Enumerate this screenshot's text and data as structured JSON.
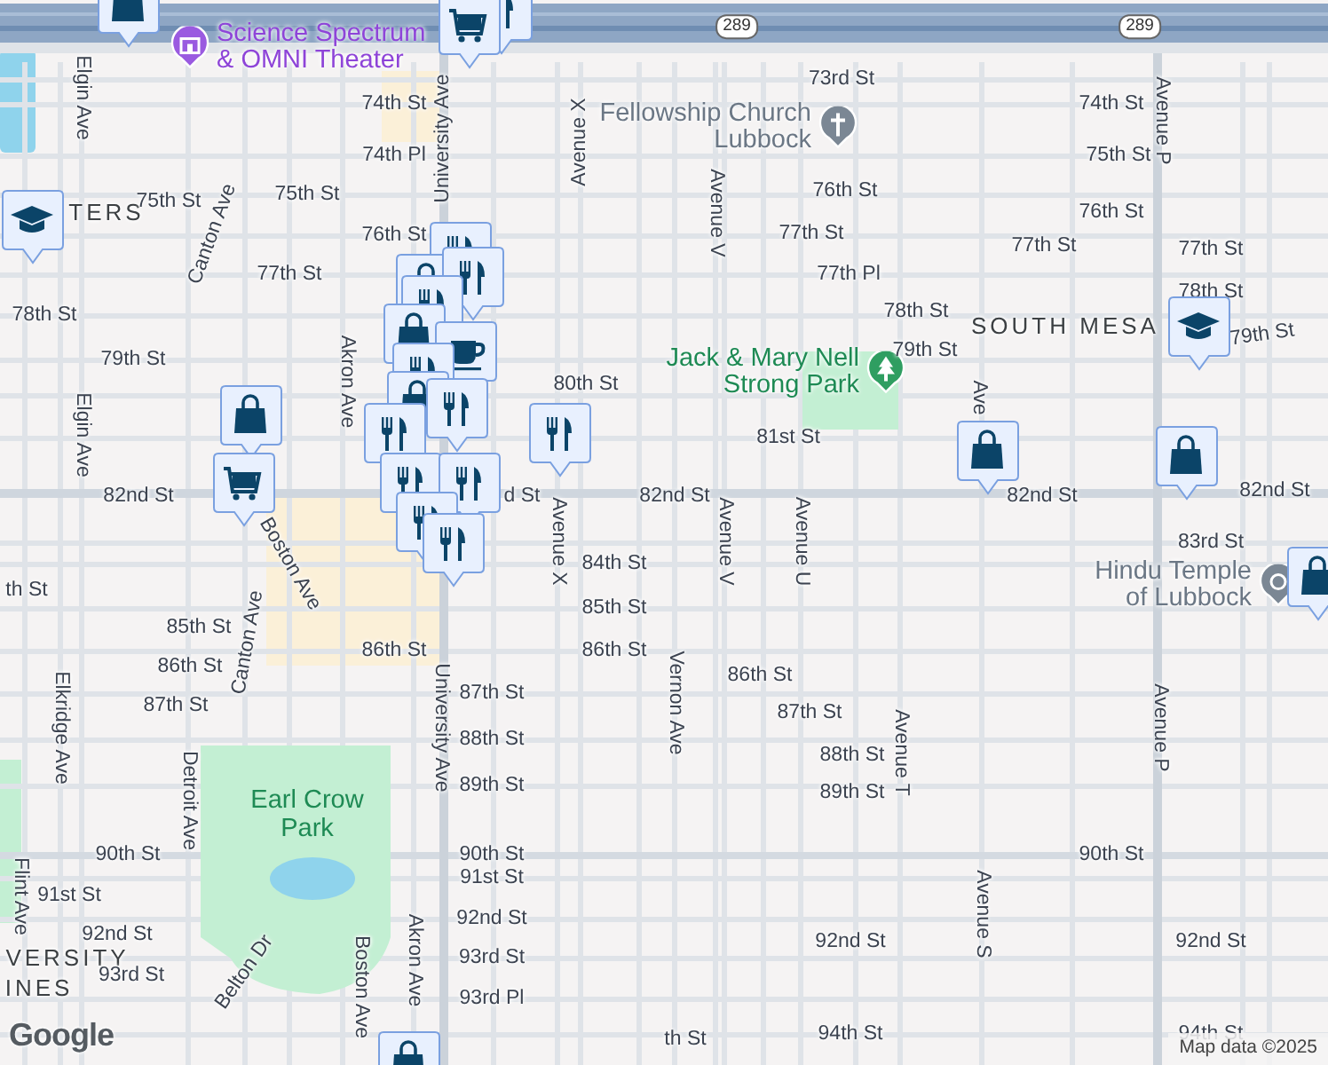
{
  "map": {
    "labels": [
      {
        "text": "Science Spectrum & OMNI Theater",
        "kind": "attraction"
      },
      {
        "text": "Fellowship Church Lubbock",
        "kind": "church"
      },
      {
        "text": "Jack & Mary Nell Strong Park",
        "kind": "park"
      },
      {
        "text": "Hindu Temple of Lubbock",
        "kind": "temple"
      },
      {
        "text": "Earl Crow Park",
        "kind": "park-area"
      },
      {
        "text": "SOUTH MESA",
        "kind": "district"
      },
      {
        "text": "TERS",
        "kind": "district"
      },
      {
        "text": "VERSITY",
        "kind": "district"
      },
      {
        "text": "INES",
        "kind": "district"
      },
      {
        "text": "73rd St",
        "kind": "street"
      },
      {
        "text": "74th St",
        "kind": "street"
      },
      {
        "text": "74th St",
        "kind": "street"
      },
      {
        "text": "74th Pl",
        "kind": "street"
      },
      {
        "text": "75th St",
        "kind": "street"
      },
      {
        "text": "75th St",
        "kind": "street"
      },
      {
        "text": "75th St",
        "kind": "street"
      },
      {
        "text": "76th St",
        "kind": "street"
      },
      {
        "text": "76th St",
        "kind": "street"
      },
      {
        "text": "76th St",
        "kind": "street"
      },
      {
        "text": "77th St",
        "kind": "street"
      },
      {
        "text": "77th St",
        "kind": "street"
      },
      {
        "text": "77th St",
        "kind": "street"
      },
      {
        "text": "77th Pl",
        "kind": "street"
      },
      {
        "text": "77th St",
        "kind": "street"
      },
      {
        "text": "78th St",
        "kind": "street"
      },
      {
        "text": "78th St",
        "kind": "street"
      },
      {
        "text": "78th St",
        "kind": "street"
      },
      {
        "text": "79th St",
        "kind": "street"
      },
      {
        "text": "79th St",
        "kind": "street"
      },
      {
        "text": "79th St",
        "kind": "street"
      },
      {
        "text": "80th St",
        "kind": "street"
      },
      {
        "text": "81st St",
        "kind": "street"
      },
      {
        "text": "82nd St",
        "kind": "street"
      },
      {
        "text": "d St",
        "kind": "street"
      },
      {
        "text": "82nd St",
        "kind": "street"
      },
      {
        "text": "82nd St",
        "kind": "street"
      },
      {
        "text": "82nd St",
        "kind": "street"
      },
      {
        "text": "83rd St",
        "kind": "street"
      },
      {
        "text": "84th St",
        "kind": "street"
      },
      {
        "text": "th St",
        "kind": "street"
      },
      {
        "text": "85th St",
        "kind": "street"
      },
      {
        "text": "85th St",
        "kind": "street"
      },
      {
        "text": "86th St",
        "kind": "street"
      },
      {
        "text": "86th St",
        "kind": "street"
      },
      {
        "text": "86th St",
        "kind": "street"
      },
      {
        "text": "86th St",
        "kind": "street"
      },
      {
        "text": "87th St",
        "kind": "street"
      },
      {
        "text": "87th St",
        "kind": "street"
      },
      {
        "text": "87th St",
        "kind": "street"
      },
      {
        "text": "88th St",
        "kind": "street"
      },
      {
        "text": "88th St",
        "kind": "street"
      },
      {
        "text": "89th St",
        "kind": "street"
      },
      {
        "text": "89th St",
        "kind": "street"
      },
      {
        "text": "90th St",
        "kind": "street"
      },
      {
        "text": "90th St",
        "kind": "street"
      },
      {
        "text": "90th St",
        "kind": "street"
      },
      {
        "text": "91st St",
        "kind": "street"
      },
      {
        "text": "91st St",
        "kind": "street"
      },
      {
        "text": "92nd St",
        "kind": "street"
      },
      {
        "text": "92nd St",
        "kind": "street"
      },
      {
        "text": "92nd St",
        "kind": "street"
      },
      {
        "text": "92nd St",
        "kind": "street"
      },
      {
        "text": "93rd St",
        "kind": "street"
      },
      {
        "text": "93rd St",
        "kind": "street"
      },
      {
        "text": "93rd Pl",
        "kind": "street"
      },
      {
        "text": "th St",
        "kind": "street"
      },
      {
        "text": "94th St",
        "kind": "street"
      },
      {
        "text": "94th St",
        "kind": "street"
      },
      {
        "text": "Elgin Ave",
        "kind": "street"
      },
      {
        "text": "Elgin Ave",
        "kind": "street"
      },
      {
        "text": "University Ave",
        "kind": "street"
      },
      {
        "text": "University Ave",
        "kind": "street"
      },
      {
        "text": "Avenue X",
        "kind": "street"
      },
      {
        "text": "Avenue X",
        "kind": "street"
      },
      {
        "text": "Avenue V",
        "kind": "street"
      },
      {
        "text": "Avenue V",
        "kind": "street"
      },
      {
        "text": "Avenue U",
        "kind": "street"
      },
      {
        "text": "Avenue T",
        "kind": "street"
      },
      {
        "text": "Avenue S",
        "kind": "street"
      },
      {
        "text": "Avenue P",
        "kind": "street"
      },
      {
        "text": "Avenue P",
        "kind": "street"
      },
      {
        "text": "Vernon Ave",
        "kind": "street"
      },
      {
        "text": "Canton Ave",
        "kind": "street"
      },
      {
        "text": "Canton Ave",
        "kind": "street"
      },
      {
        "text": "Akron Ave",
        "kind": "street"
      },
      {
        "text": "Akron Ave",
        "kind": "street"
      },
      {
        "text": "Boston Ave",
        "kind": "street"
      },
      {
        "text": "Boston Ave",
        "kind": "street"
      },
      {
        "text": "Elkridge Ave",
        "kind": "street"
      },
      {
        "text": "Detroit Ave",
        "kind": "street"
      },
      {
        "text": "Flint Ave",
        "kind": "street"
      },
      {
        "text": "Belton Dr",
        "kind": "street"
      },
      {
        "text": "Ave",
        "kind": "street"
      }
    ],
    "route_shields": [
      "289",
      "289"
    ],
    "markers": [
      {
        "kind": "shopping"
      },
      {
        "kind": "restaurant"
      },
      {
        "kind": "grocery"
      },
      {
        "kind": "school"
      },
      {
        "kind": "school"
      },
      {
        "kind": "restaurant"
      },
      {
        "kind": "shopping"
      },
      {
        "kind": "restaurant"
      },
      {
        "kind": "restaurant"
      },
      {
        "kind": "shopping"
      },
      {
        "kind": "cafe"
      },
      {
        "kind": "restaurant"
      },
      {
        "kind": "shopping"
      },
      {
        "kind": "restaurant"
      },
      {
        "kind": "restaurant"
      },
      {
        "kind": "restaurant"
      },
      {
        "kind": "shopping"
      },
      {
        "kind": "grocery"
      },
      {
        "kind": "restaurant"
      },
      {
        "kind": "restaurant"
      },
      {
        "kind": "restaurant"
      },
      {
        "kind": "restaurant"
      },
      {
        "kind": "shopping"
      },
      {
        "kind": "shopping"
      },
      {
        "kind": "shopping"
      },
      {
        "kind": "shopping"
      }
    ],
    "logo": "Google",
    "attribution": "Map data ©2025"
  }
}
